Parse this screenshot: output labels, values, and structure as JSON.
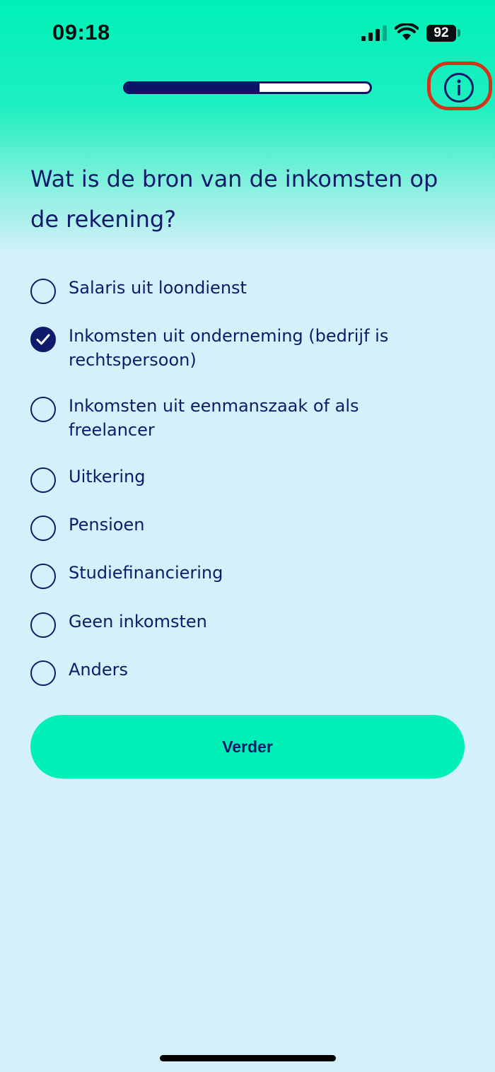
{
  "status_bar": {
    "time": "09:18",
    "battery_level": "92",
    "signal_icon": "cellular-signal-icon",
    "wifi_icon": "wifi-icon"
  },
  "progress": {
    "fraction": 0.55
  },
  "header": {
    "info_icon": "info-icon",
    "highlight_color": "#d4331b"
  },
  "question": {
    "text": "Wat is de bron van de inkomsten op de rekening?"
  },
  "options": [
    {
      "label": "Salaris uit loondienst",
      "selected": false
    },
    {
      "label": "Inkomsten uit onderneming (bedrijf is rechtspersoon)",
      "selected": true
    },
    {
      "label": "Inkomsten uit eenmanszaak of als freelancer",
      "selected": false
    },
    {
      "label": "Uitkering",
      "selected": false
    },
    {
      "label": "Pensioen",
      "selected": false
    },
    {
      "label": "Studiefinanciering",
      "selected": false
    },
    {
      "label": "Geen inkomsten",
      "selected": false
    },
    {
      "label": "Anders",
      "selected": false
    }
  ],
  "actions": {
    "continue_label": "Verder"
  },
  "colors": {
    "brand_mint": "#00f0b8",
    "navy": "#0f1a6b",
    "background": "#d3f0fb"
  }
}
